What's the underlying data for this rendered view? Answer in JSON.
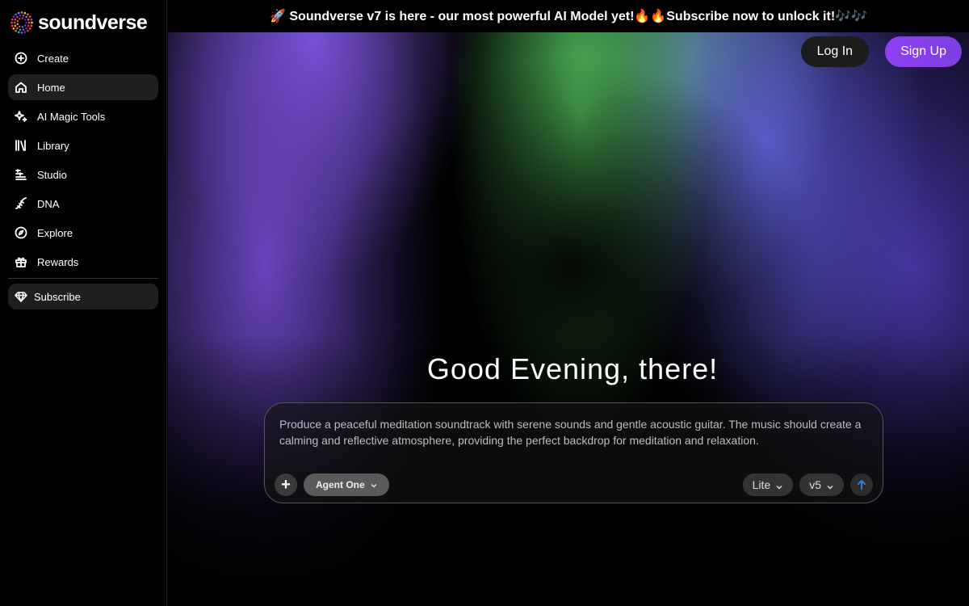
{
  "brand": {
    "name": "soundverse",
    "logo_icon": "sunburst-dots-logo"
  },
  "banner": {
    "text": "🚀 Soundverse v7 is here - our most powerful AI Model yet!🔥🔥Subscribe now to unlock it!🎶🎶"
  },
  "sidebar": {
    "items": [
      {
        "label": "Create",
        "icon": "plus-circle-icon"
      },
      {
        "label": "Home",
        "icon": "home-icon",
        "active": true
      },
      {
        "label": "AI Magic Tools",
        "icon": "sparkle-icon"
      },
      {
        "label": "Library",
        "icon": "library-icon"
      },
      {
        "label": "Studio",
        "icon": "studio-icon"
      },
      {
        "label": "DNA",
        "icon": "dna-icon"
      },
      {
        "label": "Explore",
        "icon": "compass-icon"
      },
      {
        "label": "Rewards",
        "icon": "gift-icon"
      }
    ],
    "subscribe_label": "Subscribe"
  },
  "auth": {
    "login_label": "Log In",
    "signup_label": "Sign Up"
  },
  "main": {
    "greeting": "Good Evening, there!",
    "prompt_text": "Produce a peaceful meditation soundtrack with serene sounds and gentle acoustic guitar. The music should create a calming and reflective atmosphere, providing the perfect backdrop for meditation and relaxation.",
    "agent_label": "Agent One",
    "mode_label": "Lite",
    "version_label": "v5"
  },
  "colors": {
    "signup_gradient_start": "#8f3ff0",
    "send_arrow": "#2f7fd6"
  }
}
